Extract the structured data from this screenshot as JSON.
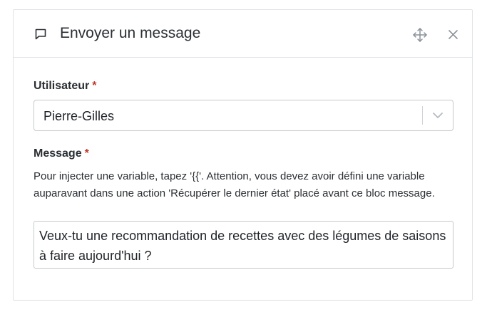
{
  "dialog": {
    "title": "Envoyer un message",
    "header_icon": "message-square-icon",
    "move_icon": "move-arrows-icon",
    "close_icon": "close-icon"
  },
  "user_field": {
    "label": "Utilisateur",
    "required_mark": "*",
    "value": "Pierre-Gilles",
    "dropdown_icon": "chevron-down-icon"
  },
  "message_field": {
    "label": "Message",
    "required_mark": "*",
    "help": "Pour injecter une variable, tapez '{{'. Attention, vous devez avoir défini une variable auparavant dans une action 'Récupérer le dernier état' placé avant ce bloc message.",
    "value": "Veux-tu une recommandation de recettes avec des légumes de saisons à faire aujourd'hui ?"
  },
  "colors": {
    "required": "#c0392b",
    "border": "#dfe3e8",
    "text": "#2b2f33"
  }
}
